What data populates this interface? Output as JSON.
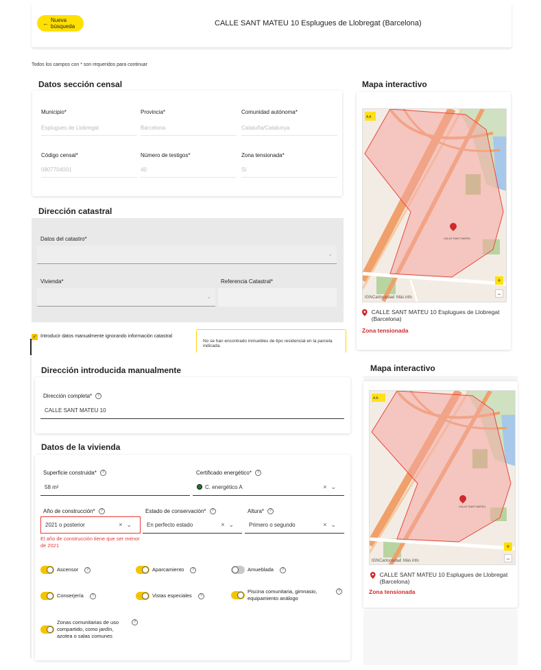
{
  "header": {
    "back_button": "Nueva búsqueda",
    "address_title": "CALLE SANT MATEU 10 Esplugues de Llobregat (Barcelona)"
  },
  "required_note": "Todos los campos con * son requeridos para continuar",
  "censal": {
    "title": "Datos sección censal",
    "municipio_label": "Municipio*",
    "municipio_value": "Esplugues de Llobregat",
    "provincia_label": "Provincia*",
    "provincia_value": "Barcelona",
    "comunidad_label": "Comunidad autónoma*",
    "comunidad_value": "Cataluña/Catalunya",
    "codigo_label": "Código censal*",
    "codigo_value": "0807704001",
    "testigos_label": "Número de testigos*",
    "testigos_value": "40",
    "tensionada_label": "Zona tensionada*",
    "tensionada_value": "Sí"
  },
  "catastral": {
    "title": "Dirección catastral",
    "datos_label": "Datos del catastro*",
    "vivienda_label": "Vivienda*",
    "referencia_label": "Referencia Catastral*",
    "manual_checkbox": "Introducir datos manualmente ignorando información catastral",
    "warning": "No se han encontrado inmuebles de tipo residencial en la parcela indicada."
  },
  "map": {
    "title": "Mapa interactivo",
    "address": "CALLE SANT MATEU 10 Esplugues de Llobregat (Barcelona)",
    "zona": "Zona tensionada",
    "attribution_1": "IGN",
    "attribution_2": "Cartociudad",
    "attribution_3": "Más info",
    "zoom_in": "+",
    "zoom_out": "−",
    "street_label": "CALLE SANT MATEU",
    "scale_badge": "A A"
  },
  "manual": {
    "title": "Dirección introducida manualmente",
    "direccion_label": "Dirección completa*",
    "direccion_value": "CALLE SANT MATEU 10"
  },
  "vivienda": {
    "title": "Datos de la vivienda",
    "superficie_label": "Superficie construida*",
    "superficie_value": "58  m²",
    "certificado_label": "Certificado energético*",
    "certificado_value": "C. energético A",
    "certificado_color": "#1b7a2a",
    "anio_label": "Año de construcción*",
    "anio_value": "2021 o posterior",
    "anio_error": "El año de construcción tiene que ser menor de 2021",
    "estado_label": "Estado de conservación*",
    "estado_value": "En perfecto estado",
    "altura_label": "Altura*",
    "altura_value": "Primero o segundo",
    "toggles": {
      "ascensor": "Ascensor",
      "aparcamiento": "Aparcamiento",
      "amueblada": "Amueblada",
      "conserjeria": "Conserjería",
      "vistas": "Vistas especiales",
      "piscina": "Piscina comunitaria, gimnasio, equipamiento análogo",
      "zonas": "Zonas comunitarias de uso compartido, como jardín, azotea o salas comunes"
    }
  },
  "colors": {
    "accent": "#ffe000",
    "toggle_on": "#f4c400",
    "error": "#e53935",
    "zona": "#d0292b"
  }
}
